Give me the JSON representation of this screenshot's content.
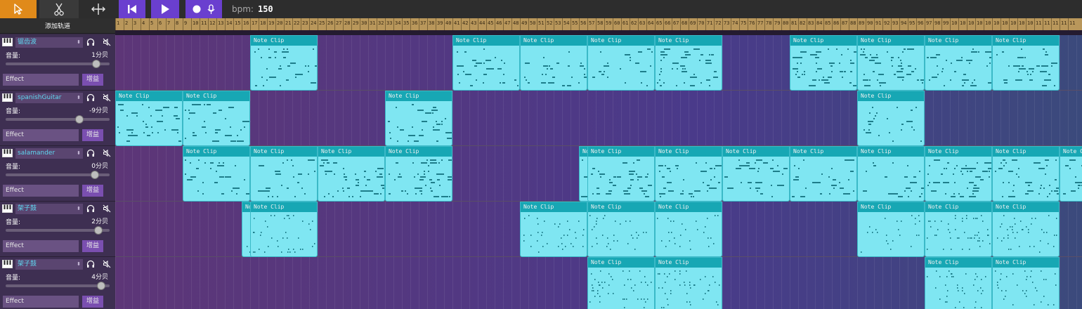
{
  "toolbar": {
    "tools": [
      {
        "name": "select-tool",
        "icon": "cursor-icon",
        "bg": "#e08a1a"
      },
      {
        "name": "cut-tool",
        "icon": "scissors-icon",
        "bg": "#3a3a3a"
      },
      {
        "name": "resize-tool",
        "icon": "resize-horizontal-icon",
        "bg": "#2d2d2d"
      },
      {
        "name": "skip-back-button",
        "icon": "skip-back-icon",
        "bg": "#6a3fcf"
      },
      {
        "name": "play-button",
        "icon": "play-icon",
        "bg": "#6a3fcf"
      },
      {
        "name": "record-button",
        "icon": "record-mic-icon",
        "bg": "#6a3fcf"
      }
    ],
    "bpm_label": "bpm:",
    "bpm_value": "150"
  },
  "sidebar": {
    "add_track": "添加轨道"
  },
  "tracks": [
    {
      "name": "锯齿波",
      "volume_label": "音量:",
      "volume_value": "1分贝",
      "slider_level": 0.87,
      "effect_label": "Effect",
      "gain_label": "增益"
    },
    {
      "name": "spanishGuitar",
      "volume_label": "音量:",
      "volume_value": "-9分贝",
      "slider_level": 0.71,
      "effect_label": "Effect",
      "gain_label": "增益"
    },
    {
      "name": "salamander",
      "volume_label": "音量:",
      "volume_value": "0分贝",
      "slider_level": 0.86,
      "effect_label": "Effect",
      "gain_label": "增益"
    },
    {
      "name": "架子鼓",
      "volume_label": "音量:",
      "volume_value": "2分贝",
      "slider_level": 0.89,
      "effect_label": "Effect",
      "gain_label": "增益"
    },
    {
      "name": "架子鼓",
      "volume_label": "音量:",
      "volume_value": "4分贝",
      "slider_level": 0.92,
      "effect_label": "Effect",
      "gain_label": "增益"
    }
  ],
  "ruler": {
    "ticks": [
      "1",
      "2",
      "3",
      "4",
      "5",
      "6",
      "7",
      "8",
      "9",
      "10",
      "11",
      "12",
      "13",
      "14",
      "15",
      "16",
      "17",
      "18",
      "19",
      "20",
      "21",
      "22",
      "23",
      "24",
      "25",
      "26",
      "27",
      "28",
      "29",
      "30",
      "31",
      "32",
      "33",
      "34",
      "35",
      "36",
      "37",
      "38",
      "39",
      "40",
      "41",
      "42",
      "43",
      "44",
      "45",
      "46",
      "47",
      "48",
      "49",
      "50",
      "51",
      "52",
      "53",
      "54",
      "55",
      "56",
      "57",
      "58",
      "59",
      "60",
      "61",
      "62",
      "63",
      "64",
      "65",
      "66",
      "67",
      "68",
      "69",
      "70",
      "71",
      "72",
      "73",
      "74",
      "75",
      "76",
      "77",
      "78",
      "79",
      "80",
      "81",
      "82",
      "83",
      "84",
      "85",
      "86",
      "87",
      "88",
      "89",
      "90",
      "91",
      "92",
      "93",
      "94",
      "95",
      "96",
      "97",
      "98",
      "99",
      "100",
      "101",
      "102",
      "103",
      "104",
      "105",
      "106",
      "107",
      "108",
      "109",
      "110",
      "111",
      "112",
      "113",
      "114"
    ]
  },
  "clip_label": "Note Clip",
  "clips": [
    {
      "track": 0,
      "bar": 17
    },
    {
      "track": 0,
      "bar": 41
    },
    {
      "track": 0,
      "bar": 49
    },
    {
      "track": 0,
      "bar": 57
    },
    {
      "track": 0,
      "bar": 65
    },
    {
      "track": 0,
      "bar": 81
    },
    {
      "track": 0,
      "bar": 89
    },
    {
      "track": 0,
      "bar": 97
    },
    {
      "track": 0,
      "bar": 105
    },
    {
      "track": 1,
      "bar": 1
    },
    {
      "track": 1,
      "bar": 9
    },
    {
      "track": 1,
      "bar": 33
    },
    {
      "track": 1,
      "bar": 89
    },
    {
      "track": 2,
      "bar": 9
    },
    {
      "track": 2,
      "bar": 17
    },
    {
      "track": 2,
      "bar": 25
    },
    {
      "track": 2,
      "bar": 33
    },
    {
      "track": 2,
      "bar": 56
    },
    {
      "track": 2,
      "bar": 57
    },
    {
      "track": 2,
      "bar": 65
    },
    {
      "track": 2,
      "bar": 73
    },
    {
      "track": 2,
      "bar": 81
    },
    {
      "track": 2,
      "bar": 89
    },
    {
      "track": 2,
      "bar": 97
    },
    {
      "track": 2,
      "bar": 105
    },
    {
      "track": 2,
      "bar": 113
    },
    {
      "track": 3,
      "bar": 16
    },
    {
      "track": 3,
      "bar": 17
    },
    {
      "track": 3,
      "bar": 49
    },
    {
      "track": 3,
      "bar": 57
    },
    {
      "track": 3,
      "bar": 65
    },
    {
      "track": 3,
      "bar": 89
    },
    {
      "track": 3,
      "bar": 97
    },
    {
      "track": 3,
      "bar": 105
    },
    {
      "track": 4,
      "bar": 57
    },
    {
      "track": 4,
      "bar": 65
    },
    {
      "track": 4,
      "bar": 97
    },
    {
      "track": 4,
      "bar": 105
    }
  ],
  "colors": {
    "accent": "#e08a1a",
    "transport": "#6a3fcf",
    "clip": "#7fe6f2",
    "clip_header": "#17a7b4",
    "track_name": "#5fd6ef"
  }
}
